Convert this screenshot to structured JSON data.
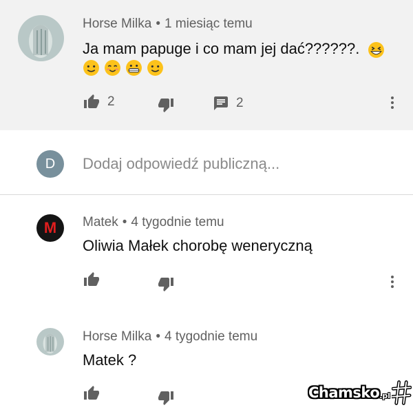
{
  "comments": [
    {
      "author": "Horse Milka",
      "separator": "•",
      "time": "1 miesiąc temu",
      "text": "Ja mam papuge i co mam jej dać??????.",
      "emoji": [
        "grinning-squint",
        "slightly-smiling",
        "smiling-eyes",
        "grimacing",
        "slightly-smiling"
      ],
      "likes": "2",
      "replies": "2"
    },
    {
      "author": "Matek",
      "separator": "•",
      "time": "4 tygodnie temu",
      "text": "Oliwia Małek chorobę weneryczną",
      "avatar_letter": "M"
    },
    {
      "author": "Horse Milka",
      "separator": "•",
      "time": "4 tygodnie temu",
      "text": "Matek ?"
    }
  ],
  "reply_box": {
    "avatar_letter": "D",
    "placeholder": "Dodaj odpowiedź publiczną..."
  },
  "watermark": {
    "text": "Chamsko",
    "tld": ".pl"
  },
  "colors": {
    "highlight_bg": "#f2f2f2",
    "reply_avatar": "#78909c",
    "icon": "#606060"
  }
}
